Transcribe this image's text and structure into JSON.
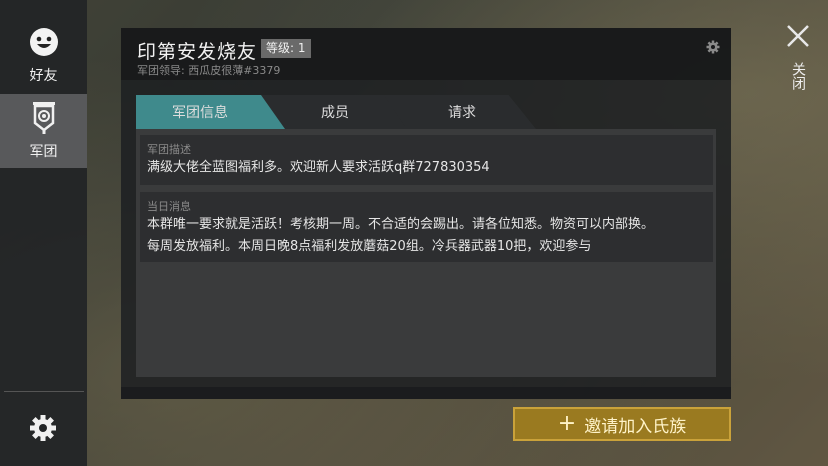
{
  "sidebar": {
    "friends_label": "好友",
    "guild_label": "军团",
    "icons": [
      "smiley-icon",
      "guild-banner-icon",
      "gear-icon"
    ]
  },
  "panel": {
    "title": "印第安发烧友",
    "level": "等级: 1",
    "leader": "军团领导: 西瓜皮很薄#3379"
  },
  "tabs": [
    {
      "label": "军团信息",
      "active": true
    },
    {
      "label": "成员",
      "active": false
    },
    {
      "label": "请求",
      "active": false
    }
  ],
  "description": {
    "label": "军团描述",
    "text": "满级大佬全蓝图福利多。欢迎新人要求活跃q群727830354"
  },
  "daily": {
    "label": "当日消息",
    "line1": "本群唯一要求就是活跃！考核期一周。不合适的会踢出。请各位知悉。物资可以内部换。",
    "line2": "每周发放福利。本周日晚8点福利发放蘑菇20组。冷兵器武器10把，欢迎参与"
  },
  "close_label": "关闭",
  "invite_label": "邀请加入氏族",
  "colors": {
    "tab_active": "#3f8a8c",
    "invite_bg": "#9a7a20",
    "invite_border": "#caa23a"
  }
}
